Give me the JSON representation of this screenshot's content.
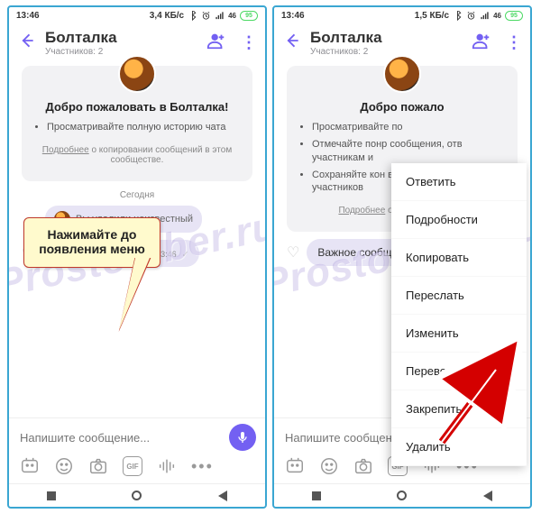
{
  "status": {
    "time": "13:46",
    "net_left": "3,4 КБ/с",
    "net_right": "1,5 КБ/с",
    "battery": "95"
  },
  "header": {
    "title": "Болталка",
    "sub": "Участников: 2"
  },
  "card": {
    "title": "Добро пожаловать в Болталка!",
    "b1": "Просматривайте полную историю чата",
    "b2": "Отмечайте понравившиеся сообщения, отвечайте участникам и упоминайте их",
    "b3": "Сохраняйте конфиденциальность — ваш номер телефона скрыт от всех участников",
    "b1s": "Просматривайте по",
    "b2s": "Отмечайте понр сообщения, отв участникам и",
    "b3s": "Сохраняйте кон ваш номер теле участников",
    "more_link": "Подробнее",
    "more_tail": " о копировании сообщений в этом сообществе.",
    "more_tail_s": " о сообщений в это"
  },
  "day": "Сегодня",
  "deleted": "Вы удалили неизвестный",
  "msg": {
    "text": "Важное сообщение",
    "time": "13:46"
  },
  "composer": {
    "placeholder": "Напишите сообщение..."
  },
  "callout": "Нажимайте до появления меню",
  "menu": {
    "m0": "Ответить",
    "m1": "Подробности",
    "m2": "Копировать",
    "m3": "Переслать",
    "m4": "Изменить",
    "m5": "Перевести",
    "m6": "Закрепить",
    "m7": "Удалить"
  },
  "gif": "GIF",
  "watermark": "ProstoViber.ru"
}
